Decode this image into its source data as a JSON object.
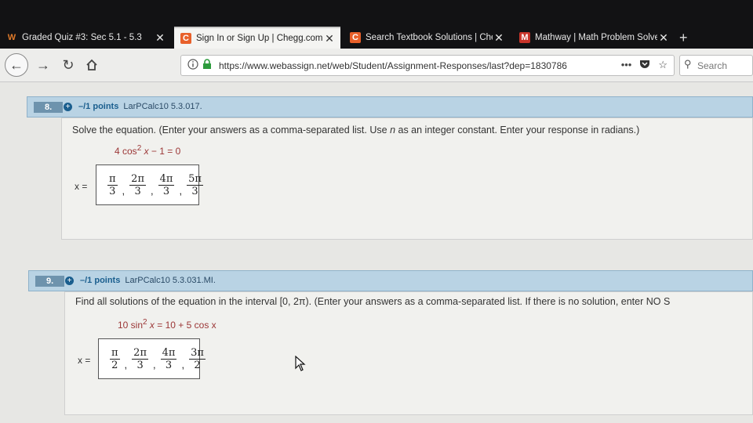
{
  "tabs": [
    {
      "label": "Graded Quiz #3: Sec 5.1 - 5.3",
      "icon": "webassign-icon",
      "close": "✕"
    },
    {
      "label": "Sign In or Sign Up | Chegg.com",
      "icon": "chegg-icon",
      "close": "✕"
    },
    {
      "label": "Search Textbook Solutions | Cheg",
      "icon": "chegg-icon",
      "close": "✕"
    },
    {
      "label": "Mathway | Math Problem Solver",
      "icon": "mathway-icon",
      "close": "✕"
    }
  ],
  "new_tab": "+",
  "nav": {
    "url_main": "https://www.webassign.net/web/Student/Assignment-Responses/last?dep=1830786",
    "url_faded": "",
    "search_placeholder": "Search",
    "menu_dots": "•••"
  },
  "questions": [
    {
      "number": "8.",
      "points": "–/1 points",
      "source": "LarPCalc10 5.3.017.",
      "prompt_pre": "Solve the equation. (Enter your answers as a comma-separated list. Use ",
      "prompt_var": "n",
      "prompt_post": " as an integer constant. Enter your response in radians.)",
      "equation_left": "4 cos",
      "equation_exp": "2",
      "equation_var": " x",
      "equation_right": " − 1 = 0",
      "answer_label": "x =",
      "answers": [
        {
          "num": "π",
          "den": "3"
        },
        {
          "num": "2π",
          "den": "3"
        },
        {
          "num": "4π",
          "den": "3"
        },
        {
          "num": "5π",
          "den": "3"
        }
      ]
    },
    {
      "number": "9.",
      "points": "–/1 points",
      "source": "LarPCalc10 5.3.031.MI.",
      "prompt_pre": "Find all solutions of the equation in the interval [0, 2π). (Enter your answers as a comma-separated list. If there is no solution, enter NO S",
      "prompt_var": "",
      "prompt_post": "",
      "equation_left": "10 sin",
      "equation_exp": "2",
      "equation_var": " x",
      "equation_right": " = 10 + 5 cos x",
      "answer_label": "x =",
      "answers": [
        {
          "num": "π",
          "den": "2"
        },
        {
          "num": "2π",
          "den": "3"
        },
        {
          "num": "4π",
          "den": "3"
        },
        {
          "num": "3π",
          "den": "2"
        }
      ]
    }
  ],
  "colors": {
    "header_bg": "#b9d3e4",
    "points_blue": "#1a5e8e",
    "equation_red": "#9b3636"
  }
}
